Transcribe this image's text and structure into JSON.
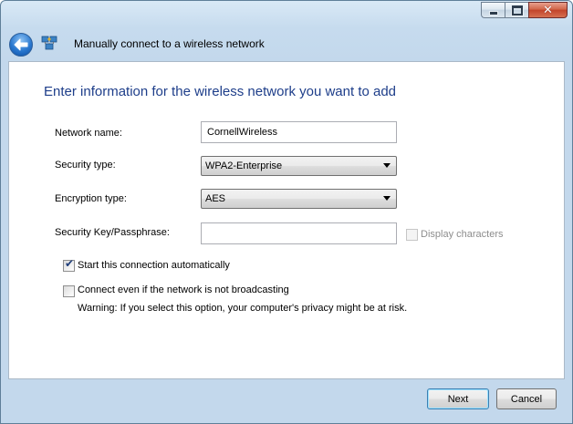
{
  "window": {
    "title": "Manually connect to a wireless network"
  },
  "header": {
    "back_icon": "back-arrow-icon",
    "app_icon": "wireless-network-icon"
  },
  "main": {
    "instruction": "Enter information for the wireless network you want to add",
    "network_name": {
      "label": "Network name:",
      "value": "CornellWireless"
    },
    "security_type": {
      "label": "Security type:",
      "selected": "WPA2-Enterprise"
    },
    "encryption_type": {
      "label": "Encryption type:",
      "selected": "AES"
    },
    "security_key": {
      "label": "Security Key/Passphrase:",
      "value": ""
    },
    "display_characters": {
      "label": "Display characters",
      "checked": false,
      "enabled": false
    },
    "start_automatically": {
      "label": "Start this connection automatically",
      "checked": true
    },
    "connect_not_broadcasting": {
      "label": "Connect even if the network is not broadcasting",
      "checked": false
    },
    "warning": "Warning: If you select this option, your computer's privacy might be at risk."
  },
  "footer": {
    "next_label": "Next",
    "cancel_label": "Cancel"
  },
  "colors": {
    "instruction_text": "#1e3e8a",
    "frame": "#c3d8ec"
  }
}
